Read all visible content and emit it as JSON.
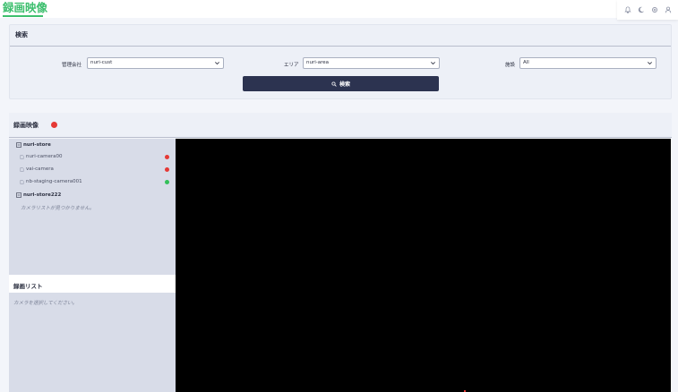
{
  "app": {
    "title": "録画映像"
  },
  "header_icons": [
    "bell-icon",
    "moon-icon",
    "gear-icon",
    "user-icon"
  ],
  "search": {
    "title": "検索",
    "company": {
      "label": "管理会社",
      "value": "nuri-cust"
    },
    "area": {
      "label": "エリア",
      "value": "nuri-area"
    },
    "facility": {
      "label": "施設",
      "value": "All"
    },
    "button_label": "検索"
  },
  "recording": {
    "title": "録画映像",
    "status_color": "#e53935"
  },
  "camera_tree": {
    "stores": [
      {
        "name": "nuri-store",
        "cameras": [
          {
            "name": "nuri-camera00",
            "status": "offline",
            "status_color": "#e53935"
          },
          {
            "name": "vai-camera",
            "status": "offline",
            "status_color": "#e53935"
          },
          {
            "name": "nb-staging-camera001",
            "status": "online",
            "status_color": "#34c05a"
          }
        ]
      },
      {
        "name": "nuri-store222",
        "empty_message": "カメラリストが見つかりません。"
      }
    ]
  },
  "record_list": {
    "title": "録画リスト",
    "placeholder": "カメラを選択してください。"
  },
  "colors": {
    "accent_green": "#3dbf6e",
    "button_dark": "#2c3350",
    "panel_bg": "#edf0f7",
    "sidebar_bg": "#d8dce8"
  }
}
